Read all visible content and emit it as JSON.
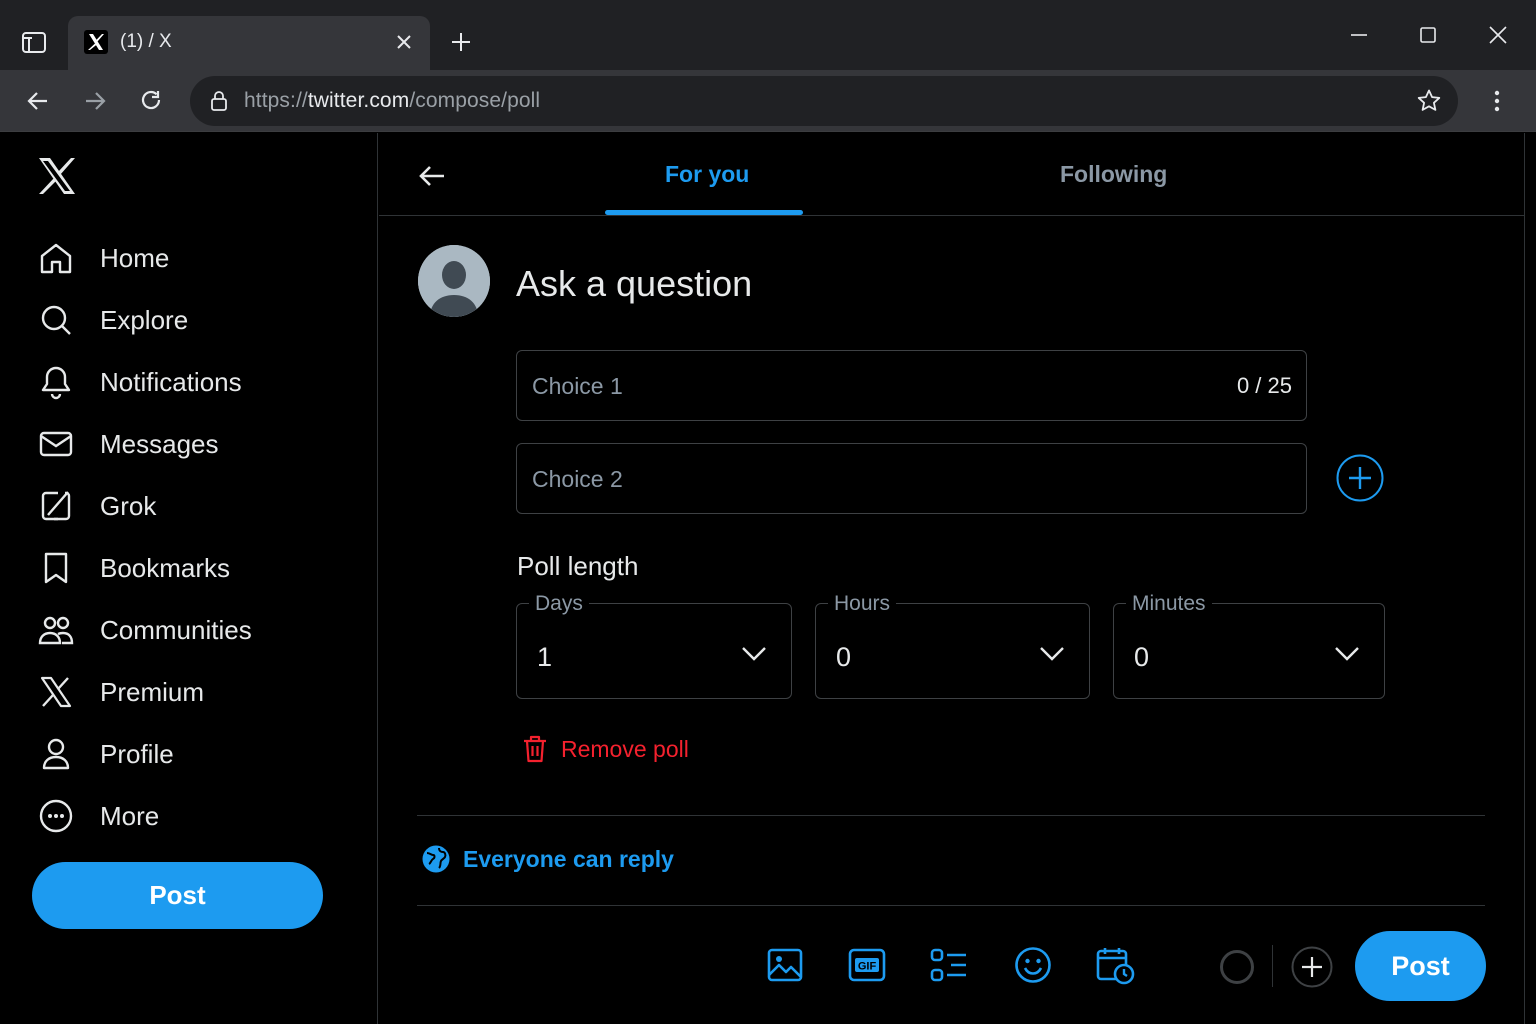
{
  "browser": {
    "tab_title": "(1) / X",
    "url_prefix": "https://",
    "url_domain": "twitter.com",
    "url_path": "/compose/poll"
  },
  "sidebar": {
    "items": [
      {
        "label": "Home",
        "icon": "home-icon"
      },
      {
        "label": "Explore",
        "icon": "search-icon"
      },
      {
        "label": "Notifications",
        "icon": "bell-icon"
      },
      {
        "label": "Messages",
        "icon": "envelope-icon"
      },
      {
        "label": "Grok",
        "icon": "grok-icon"
      },
      {
        "label": "Bookmarks",
        "icon": "bookmark-icon"
      },
      {
        "label": "Communities",
        "icon": "people-icon"
      },
      {
        "label": "Premium",
        "icon": "x-icon"
      },
      {
        "label": "Profile",
        "icon": "person-icon"
      },
      {
        "label": "More",
        "icon": "more-circle-icon"
      }
    ],
    "post_label": "Post"
  },
  "main": {
    "tabs": [
      {
        "label": "For you",
        "active": true
      },
      {
        "label": "Following",
        "active": false
      }
    ],
    "question_placeholder": "Ask a question",
    "choices": [
      {
        "placeholder": "Choice 1",
        "counter": "0 / 25"
      },
      {
        "placeholder": "Choice 2"
      }
    ],
    "poll_length_label": "Poll length",
    "selects": [
      {
        "label": "Days",
        "value": "1"
      },
      {
        "label": "Hours",
        "value": "0"
      },
      {
        "label": "Minutes",
        "value": "0"
      }
    ],
    "remove_poll": "Remove poll",
    "reply_setting": "Everyone can reply",
    "post_label": "Post",
    "accent_color": "#1d9bf0",
    "danger_color": "#f4212e"
  }
}
